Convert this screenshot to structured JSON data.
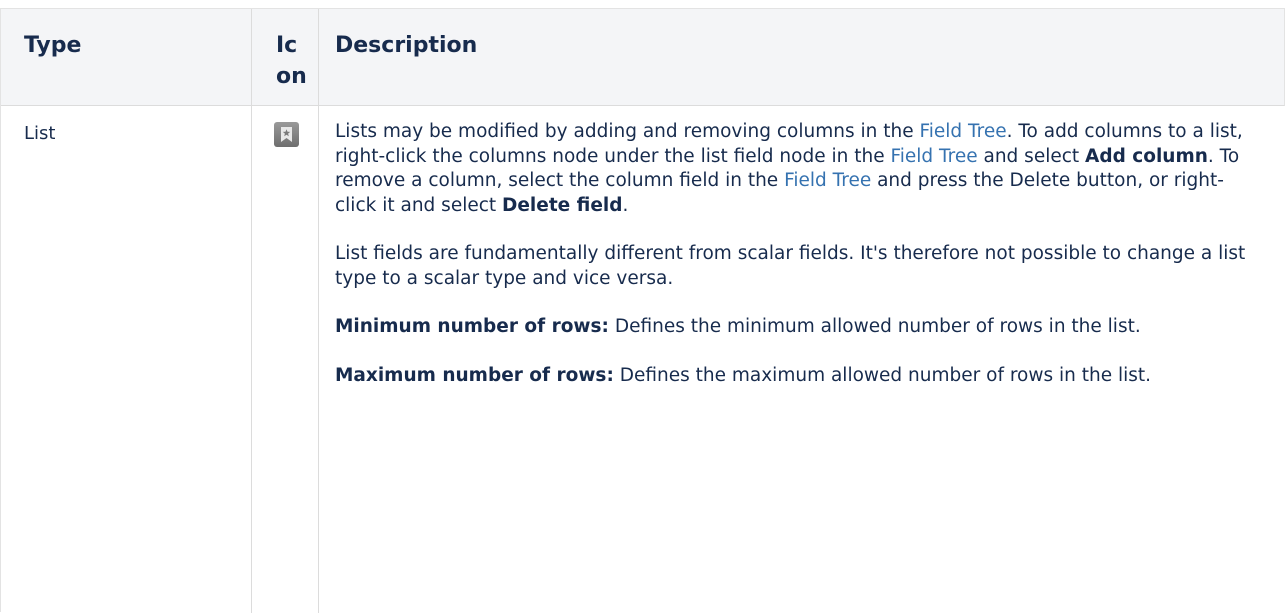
{
  "table": {
    "headers": {
      "type": "Type",
      "icon": "Icon",
      "description": "Description"
    },
    "row": {
      "type": "List",
      "icon": "list-field-icon",
      "paragraph1": {
        "part1": "Lists may be modified by adding and removing columns in the ",
        "link1": "Field Tree",
        "part2": ". To add columns to a list, right-click the columns node under the list field node in the ",
        "link2": "Field Tree",
        "part3": " and select ",
        "bold1": "Add column",
        "part4": ". To remove a column, select the column field in the ",
        "link3": "Field Tree",
        "part5": " and press the Delete button, or right-click it and select ",
        "bold2": "Delete field",
        "part6": "."
      },
      "paragraph2": "List fields are fundamentally different from scalar fields. It's therefore not possible to change a list type to a scalar type and vice versa.",
      "paragraph3": {
        "label": "Minimum number of rows:",
        "text": " Defines the minimum allowed number of rows in the list."
      },
      "paragraph4": {
        "label": "Maximum number of rows:",
        "text": " Defines the maximum allowed number of rows in the list."
      }
    }
  }
}
